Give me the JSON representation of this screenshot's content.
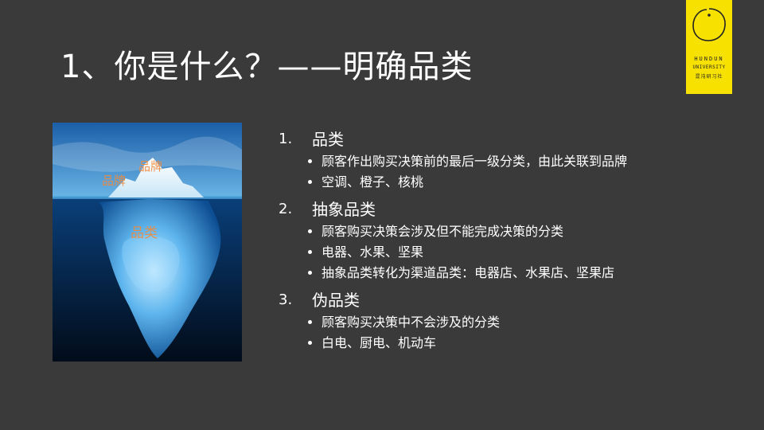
{
  "slide": {
    "title": "1、你是什么？——明确品类"
  },
  "logo": {
    "line1": "HUNDUN",
    "line2": "UNIVERSITY",
    "line3": "混沌研习社"
  },
  "iceberg": {
    "labels": [
      "品牌",
      "品牌",
      "品类"
    ]
  },
  "sections": [
    {
      "number": "1.",
      "heading": "品类",
      "bullets": [
        "顾客作出购买决策前的最后一级分类，由此关联到品牌",
        "空调、橙子、核桃"
      ]
    },
    {
      "number": "2.",
      "heading": "抽象品类",
      "bullets": [
        "顾客购买决策会涉及但不能完成决策的分类",
        "电器、水果、坚果",
        "抽象品类转化为渠道品类：电器店、水果店、坚果店"
      ]
    },
    {
      "number": "3.",
      "heading": "伪品类",
      "bullets": [
        "顾客购买决策中不会涉及的分类",
        "白电、厨电、机动车"
      ]
    }
  ],
  "colors": {
    "background": "#3a3a3a",
    "logo_bg": "#f7e100",
    "label_orange": "#f08a3c"
  }
}
